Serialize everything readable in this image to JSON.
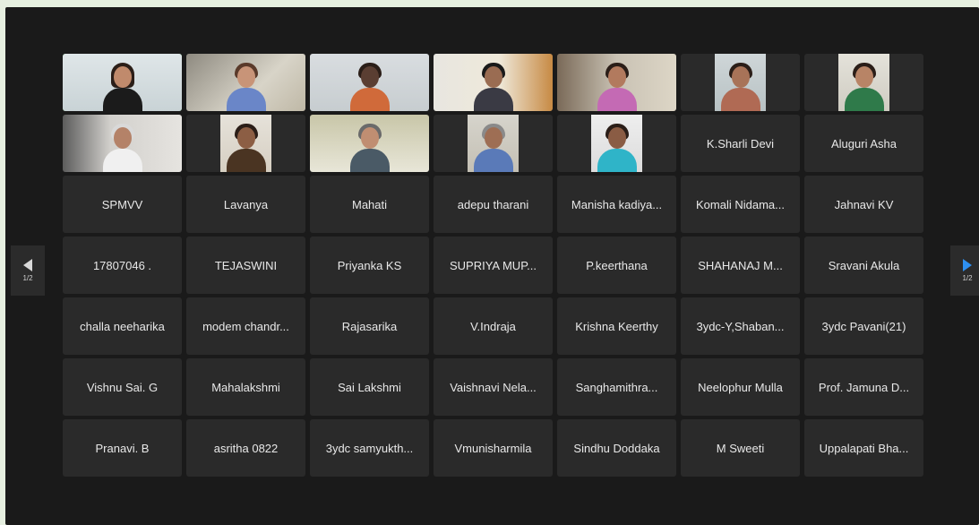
{
  "pager": {
    "label": "1/2",
    "prev_icon": "chevron-left-icon",
    "next_icon": "chevron-right-icon"
  },
  "colors": {
    "background": "#1a1a1a",
    "tile": "#2a2a2a",
    "active_speaker": "#3cc94f",
    "next_arrow": "#2e8ff0"
  },
  "participants_names": [
    "K.Sharli Devi",
    "Aluguri Asha",
    "SPMVV",
    "Lavanya",
    "Mahati",
    "adepu tharani",
    "Manisha kadiya...",
    "Komali Nidama...",
    "Jahnavi KV",
    "17807046 .",
    "TEJASWINI",
    "Priyanka KS",
    "SUPRIYA MUP...",
    "P.keerthana",
    "SHAHANAJ M...",
    "Sravani Akula",
    "challa neeharika",
    "modem chandr...",
    "Rajasarika",
    "V.Indraja",
    "Krishna Keerthy",
    "3ydc-Y,Shaban...",
    "3ydc Pavani(21)",
    "Vishnu Sai. G",
    "Mahalakshmi",
    "Sai Lakshmi",
    "Vaishnavi Nela...",
    "Sanghamithra...",
    "Neelophur Mulla",
    "Prof. Jamuna D...",
    "Pranavi. B",
    "asritha 0822",
    "3ydc samyukth...",
    "Vmunisharmila",
    "Sindhu Doddaka",
    "M Sweeti",
    "Uppalapati Bha..."
  ]
}
